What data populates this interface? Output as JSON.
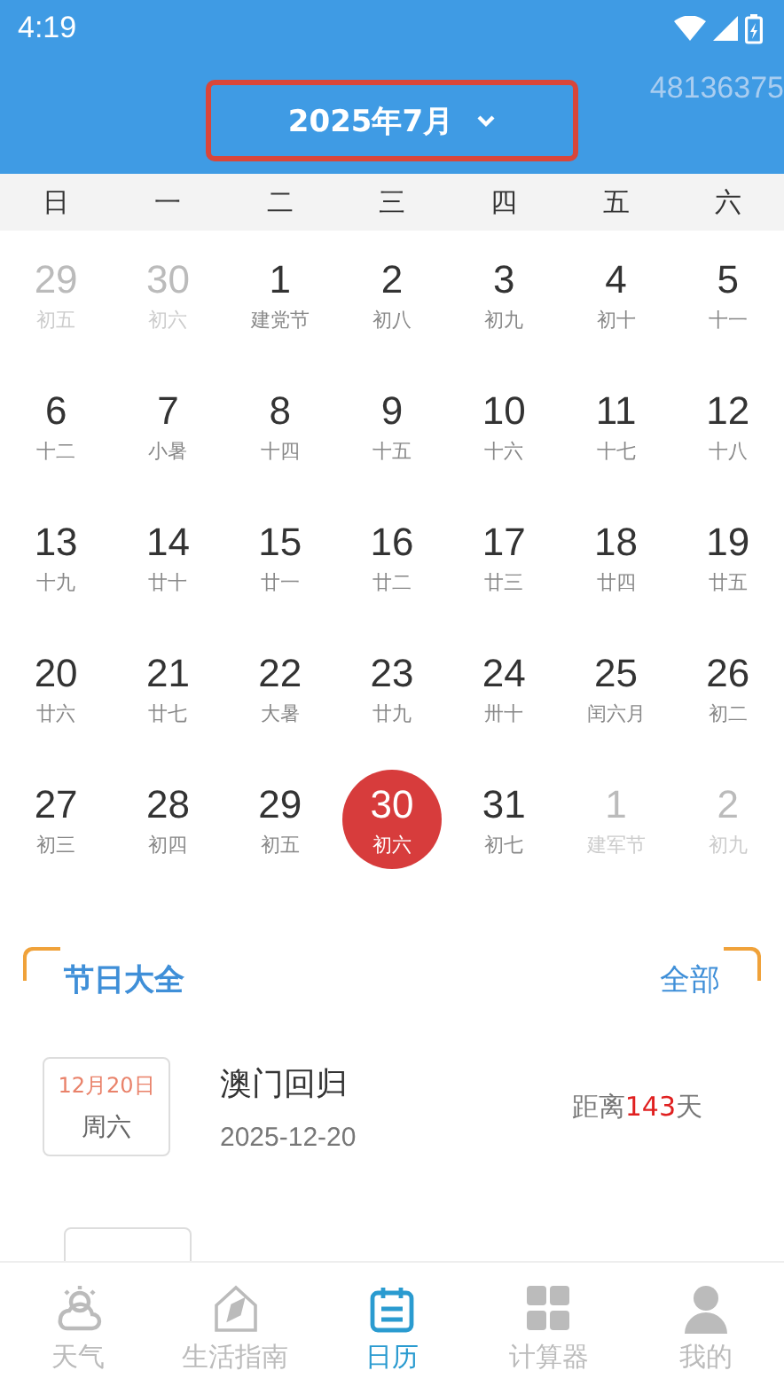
{
  "status_bar": {
    "time": "4:19"
  },
  "header": {
    "month": "2025年7月",
    "side_number": "48136375"
  },
  "weekdays": [
    "日",
    "一",
    "二",
    "三",
    "四",
    "五",
    "六"
  ],
  "days": [
    {
      "day": "29",
      "lunar": "初五",
      "muted": true,
      "selected": false
    },
    {
      "day": "30",
      "lunar": "初六",
      "muted": true,
      "selected": false
    },
    {
      "day": "1",
      "lunar": "建党节",
      "muted": false,
      "selected": false
    },
    {
      "day": "2",
      "lunar": "初八",
      "muted": false,
      "selected": false
    },
    {
      "day": "3",
      "lunar": "初九",
      "muted": false,
      "selected": false
    },
    {
      "day": "4",
      "lunar": "初十",
      "muted": false,
      "selected": false
    },
    {
      "day": "5",
      "lunar": "十一",
      "muted": false,
      "selected": false
    },
    {
      "day": "6",
      "lunar": "十二",
      "muted": false,
      "selected": false
    },
    {
      "day": "7",
      "lunar": "小暑",
      "muted": false,
      "selected": false
    },
    {
      "day": "8",
      "lunar": "十四",
      "muted": false,
      "selected": false
    },
    {
      "day": "9",
      "lunar": "十五",
      "muted": false,
      "selected": false
    },
    {
      "day": "10",
      "lunar": "十六",
      "muted": false,
      "selected": false
    },
    {
      "day": "11",
      "lunar": "十七",
      "muted": false,
      "selected": false
    },
    {
      "day": "12",
      "lunar": "十八",
      "muted": false,
      "selected": false
    },
    {
      "day": "13",
      "lunar": "十九",
      "muted": false,
      "selected": false
    },
    {
      "day": "14",
      "lunar": "廿十",
      "muted": false,
      "selected": false
    },
    {
      "day": "15",
      "lunar": "廿一",
      "muted": false,
      "selected": false
    },
    {
      "day": "16",
      "lunar": "廿二",
      "muted": false,
      "selected": false
    },
    {
      "day": "17",
      "lunar": "廿三",
      "muted": false,
      "selected": false
    },
    {
      "day": "18",
      "lunar": "廿四",
      "muted": false,
      "selected": false
    },
    {
      "day": "19",
      "lunar": "廿五",
      "muted": false,
      "selected": false
    },
    {
      "day": "20",
      "lunar": "廿六",
      "muted": false,
      "selected": false
    },
    {
      "day": "21",
      "lunar": "廿七",
      "muted": false,
      "selected": false
    },
    {
      "day": "22",
      "lunar": "大暑",
      "muted": false,
      "selected": false
    },
    {
      "day": "23",
      "lunar": "廿九",
      "muted": false,
      "selected": false
    },
    {
      "day": "24",
      "lunar": "卅十",
      "muted": false,
      "selected": false
    },
    {
      "day": "25",
      "lunar": "闰六月",
      "muted": false,
      "selected": false
    },
    {
      "day": "26",
      "lunar": "初二",
      "muted": false,
      "selected": false
    },
    {
      "day": "27",
      "lunar": "初三",
      "muted": false,
      "selected": false
    },
    {
      "day": "28",
      "lunar": "初四",
      "muted": false,
      "selected": false
    },
    {
      "day": "29",
      "lunar": "初五",
      "muted": false,
      "selected": false
    },
    {
      "day": "30",
      "lunar": "初六",
      "muted": false,
      "selected": true
    },
    {
      "day": "31",
      "lunar": "初七",
      "muted": false,
      "selected": false
    },
    {
      "day": "1",
      "lunar": "建军节",
      "muted": true,
      "selected": false
    },
    {
      "day": "2",
      "lunar": "初九",
      "muted": true,
      "selected": false
    }
  ],
  "festivals": {
    "title": "节日大全",
    "all_link": "全部",
    "items": [
      {
        "date": "12月20日",
        "weekday": "周六",
        "name": "澳门回归",
        "full_date": "2025-12-20",
        "countdown_prefix": "距离",
        "countdown_days": "143",
        "countdown_suffix": "天"
      }
    ]
  },
  "bottom_nav": [
    {
      "kind": "weather",
      "label": "天气",
      "selected": false
    },
    {
      "kind": "compass",
      "label": "生活指南",
      "selected": false
    },
    {
      "kind": "calendar",
      "label": "日历",
      "selected": true
    },
    {
      "kind": "calculator",
      "label": "计算器",
      "selected": false
    },
    {
      "kind": "person",
      "label": "我的",
      "selected": false
    }
  ]
}
